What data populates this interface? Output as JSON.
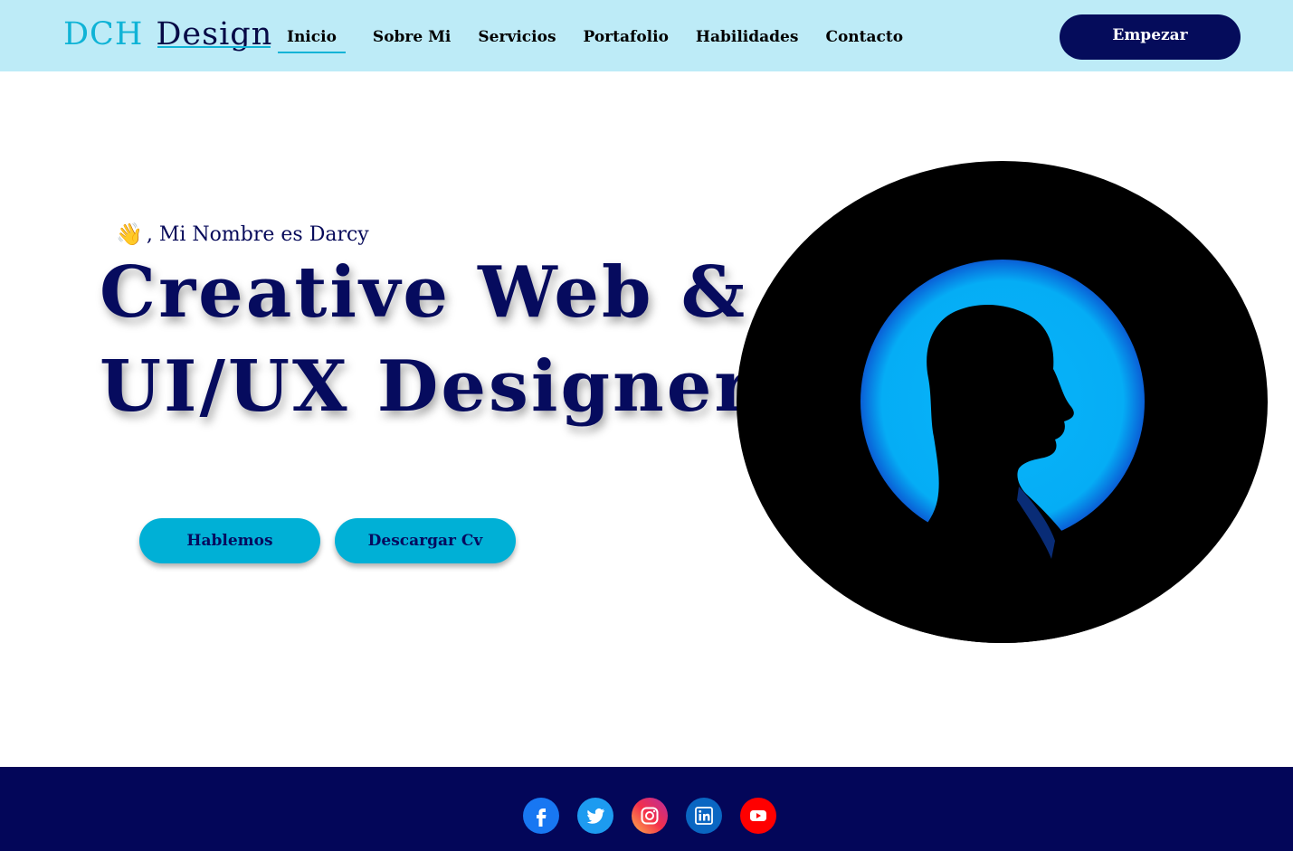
{
  "header": {
    "logo_part1": "DCH",
    "logo_part2": "Design",
    "nav": [
      "Inicio",
      "Sobre Mi",
      "Servicios",
      "Portafolio",
      "Habilidades",
      "Contacto"
    ],
    "cta_label": "Empezar"
  },
  "hero": {
    "greeting": ", Mi Nombre es Darcy",
    "headline_line1": "Creative Web &",
    "headline_line2": "UI/UX Designer.",
    "button1": "Hablemos",
    "button2": "Descargar Cv"
  },
  "footer": {
    "social_icons": [
      "facebook-icon",
      "twitter-icon",
      "instagram-icon",
      "linkedin-icon",
      "youtube-icon"
    ]
  },
  "colors": {
    "header_bg": "#bdebf7",
    "accent": "#0fb3d6",
    "navy": "#050c5b",
    "footer_bg": "#030659"
  }
}
